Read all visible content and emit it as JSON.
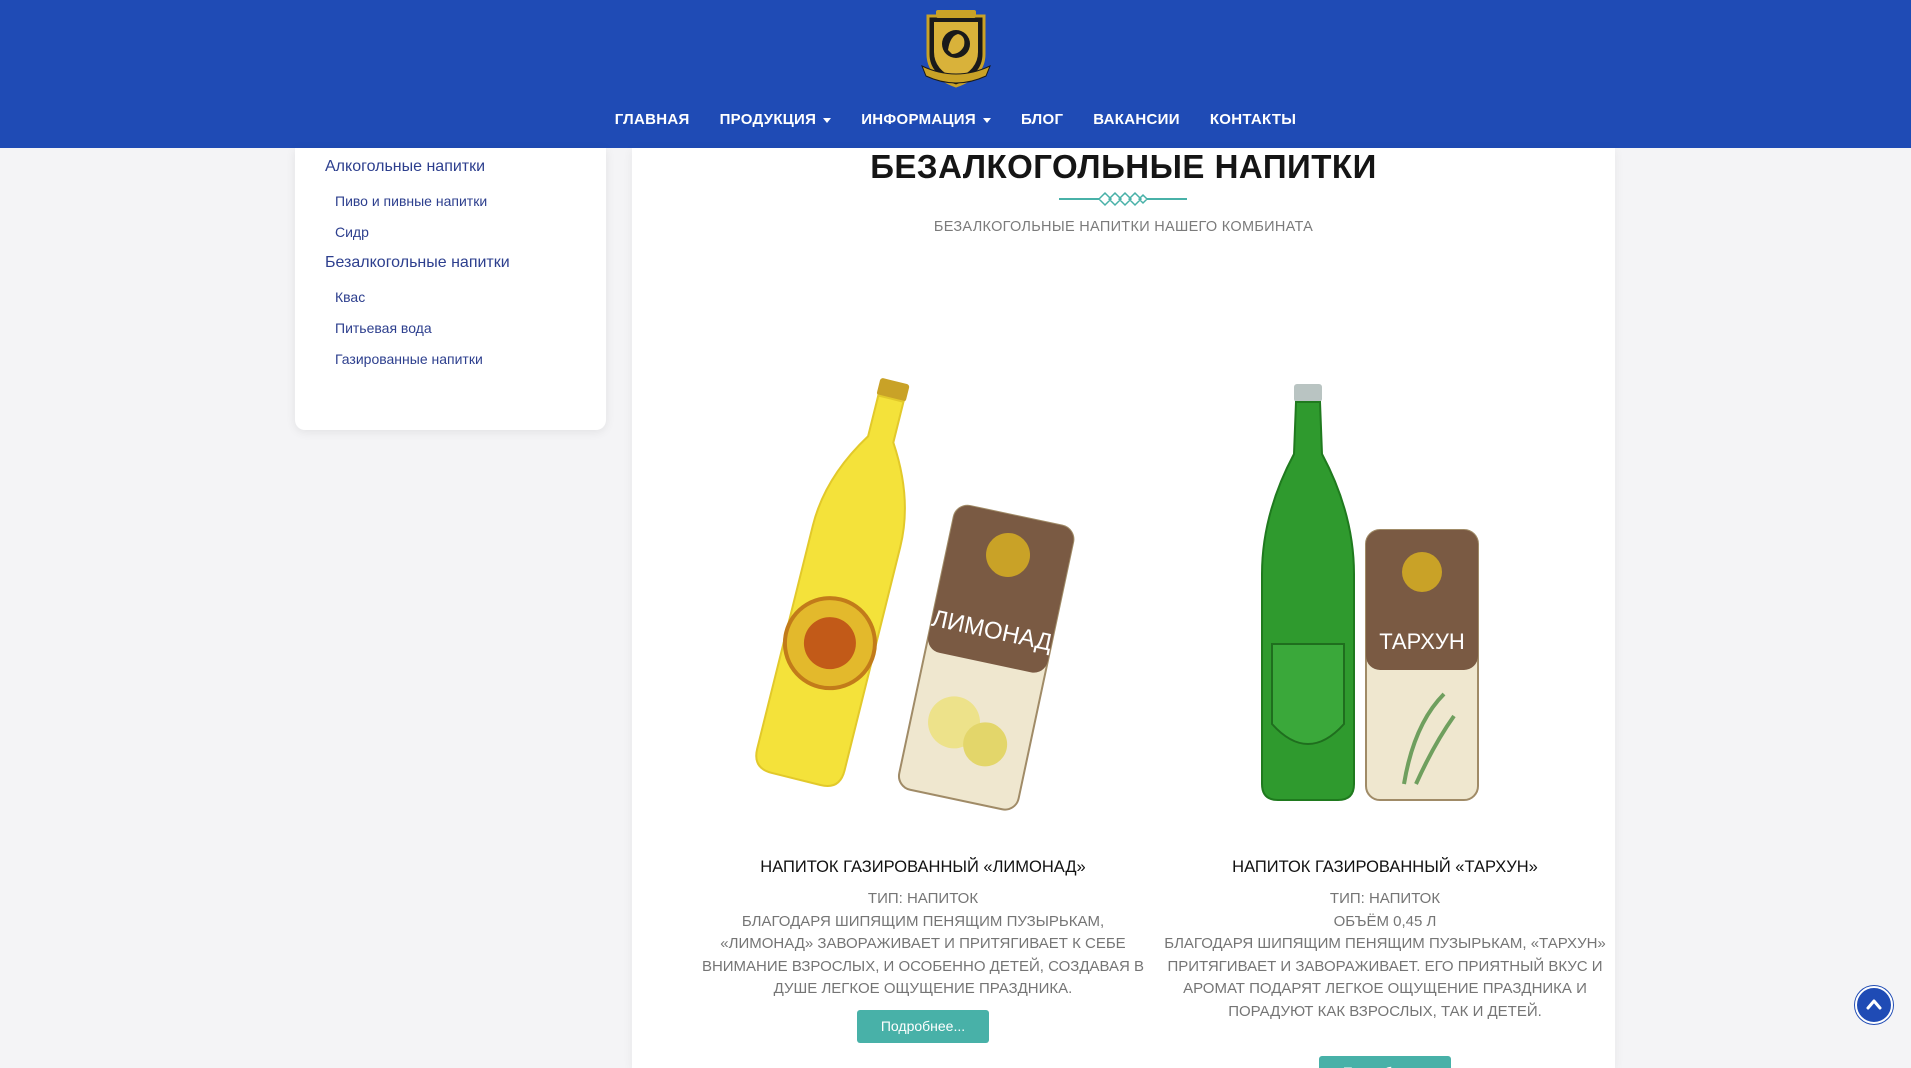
{
  "header": {
    "logo_icon": "heraldic-lion-crest",
    "nav": {
      "home": "ГЛАВНАЯ",
      "products": "ПРОДУКЦИЯ",
      "info": "ИНФОРМАЦИЯ",
      "blog": "БЛОГ",
      "jobs": "ВАКАНСИИ",
      "contacts": "КОНТАКТЫ"
    }
  },
  "sidebar": {
    "alcoholic": "Алкогольные напитки",
    "beer": "Пиво и пивные напитки",
    "cider": "Сидр",
    "nonalcoholic": "Безалкогольные напитки",
    "kvass": "Квас",
    "water": "Питьевая вода",
    "soda": "Газированные напитки"
  },
  "main": {
    "title": "БЕЗАЛКОГОЛЬНЫЕ НАПИТКИ",
    "subtitle": "БЕЗАЛКОГОЛЬНЫЕ НАПИТКИ НАШЕГО КОМБИНАТА",
    "products": [
      {
        "title": "НАПИТОК ГАЗИРОВАННЫЙ «ЛИМОНАД»",
        "desc": "ТИП: НАПИТОК\nБЛАГОДАРЯ ШИПЯЩИМ ПЕНЯЩИМ ПУЗЫРЬКАМ, «ЛИМОНАД» ЗАВОРАЖИВАЕТ И ПРИТЯГИВАЕТ К СЕБЕ ВНИМАНИЕ ВЗРОСЛЫХ, И ОСОБЕННО ДЕТЕЙ, СОЗДАВАЯ В ДУШЕ ЛЕГКОЕ ОЩУЩЕНИЕ ПРАЗДНИКА.",
        "button": "Подробнее...",
        "image_icon": "lemonade-bottle-and-can",
        "label_text": "ЛИМОНАД",
        "bottle_color": "#f4e23a"
      },
      {
        "title": "НАПИТОК ГАЗИРОВАННЫЙ «ТАРХУН»",
        "desc": "ТИП: НАПИТОК\nОБЪЁМ 0,45 Л\nБЛАГОДАРЯ ШИПЯЩИМ ПЕНЯЩИМ ПУЗЫРЬКАМ, «ТАРХУН» ПРИТЯГИВАЕТ И ЗАВОРАЖИВАЕТ. ЕГО ПРИЯТНЫЙ ВКУС И АРОМАТ ПОДАРЯТ ЛЕГКОЕ ОЩУЩЕНИЕ ПРАЗДНИКА И ПОРАДУЮТ КАК ВЗРОСЛЫХ, ТАК И ДЕТЕЙ.",
        "button": "Подробнее...",
        "image_icon": "tarragon-bottle-and-can",
        "label_text": "ТАРХУН",
        "bottle_color": "#2f9a2e"
      }
    ]
  },
  "colors": {
    "brand_blue": "#1f4bb5",
    "teal": "#48b1a8",
    "link_blue": "#2d3f8e"
  }
}
